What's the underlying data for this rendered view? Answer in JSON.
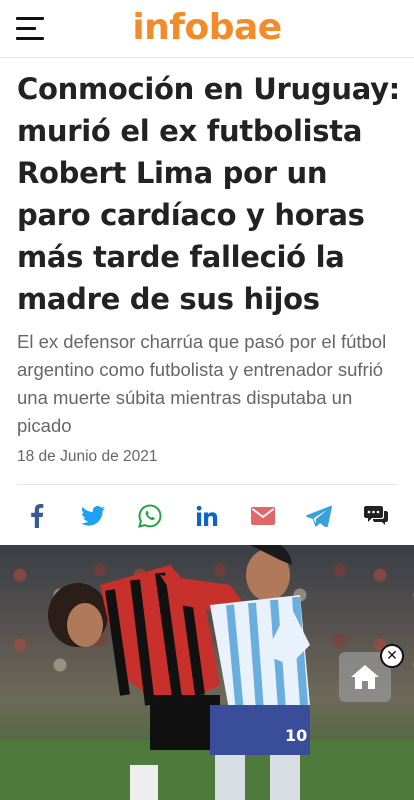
{
  "header": {
    "menu_icon": "hamburger-menu-icon",
    "logo_text": "infobae",
    "logo_color": "#f28c28"
  },
  "article": {
    "headline": "Conmoción en Uruguay: murió el ex futbolista Robert Lima por un paro cardíaco y horas más tarde falleció la madre de sus hijos",
    "subhead": "El ex defensor charrúa que pasó por el fútbol argentino como futbolista y entrenador sufrió una muerte súbita mientras disputaba un picado",
    "date": "18 de Junio de 2021"
  },
  "share": {
    "icons": [
      "facebook-icon",
      "twitter-icon",
      "whatsapp-icon",
      "linkedin-icon",
      "email-icon",
      "telegram-icon",
      "comments-icon"
    ],
    "colors": {
      "facebook": "#3b5998",
      "twitter": "#1da1f2",
      "whatsapp": "#25a244",
      "linkedin": "#0a66c2",
      "email": "#e0676a",
      "telegram": "#3aa0d8",
      "comments": "#222222"
    }
  },
  "overlay": {
    "home_icon": "home-icon",
    "close_icon": "close-icon",
    "close_glyph": "✕"
  }
}
